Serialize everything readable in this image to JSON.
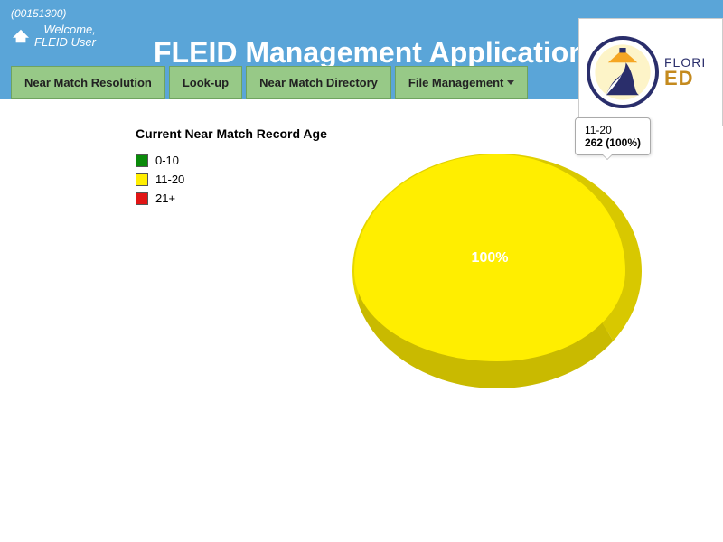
{
  "header": {
    "code": "(00151300)",
    "welcome_line1": "Welcome,",
    "welcome_line2": "FLEID User",
    "app_title": "FLEID Management Application",
    "logo_line1": "FLORI",
    "logo_line2": "ED"
  },
  "nav": {
    "items": [
      "Near Match Resolution",
      "Look-up",
      "Near Match Directory",
      "File Management"
    ]
  },
  "chart": {
    "title": "Current Near Match Record Age",
    "legend": [
      {
        "label": "0-10",
        "color": "#0a8a0a"
      },
      {
        "label": "11-20",
        "color": "#ffee00"
      },
      {
        "label": "21+",
        "color": "#e11515"
      }
    ],
    "slice_label": "100%",
    "tooltip_label": "11-20",
    "tooltip_value": "262 (100%)"
  },
  "chart_data": {
    "type": "pie",
    "title": "Current Near Match Record Age",
    "categories": [
      "0-10",
      "11-20",
      "21+"
    ],
    "values": [
      0,
      262,
      0
    ],
    "percentages": [
      0,
      100,
      0
    ],
    "colors": [
      "#0a8a0a",
      "#ffee00",
      "#e11515"
    ]
  }
}
